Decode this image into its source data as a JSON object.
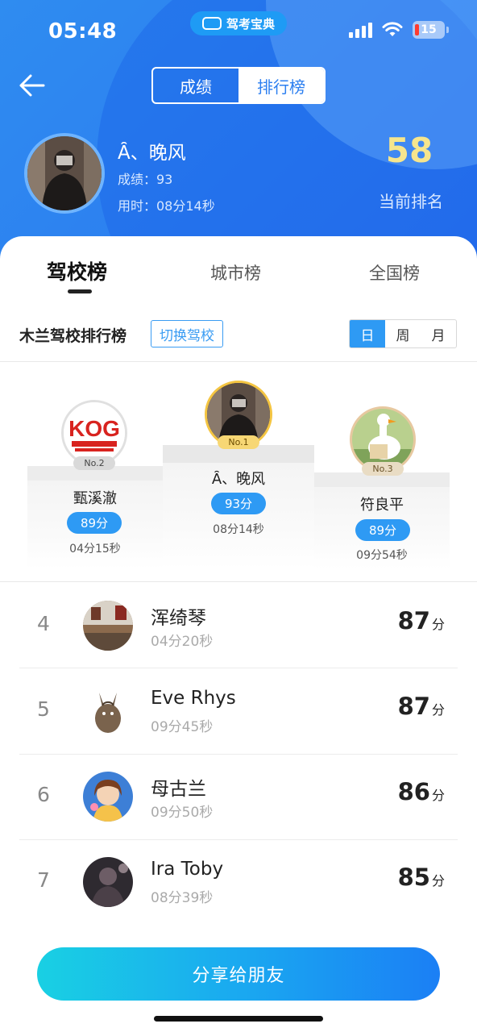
{
  "status_bar": {
    "time": "05:48",
    "app_badge": "驾考宝典",
    "battery": "15"
  },
  "nav": {
    "back_icon": "back-arrow-icon",
    "segments": [
      {
        "label": "成绩",
        "active": false
      },
      {
        "label": "排行榜",
        "active": true
      }
    ]
  },
  "me": {
    "name": "Ȃ、晚风",
    "score_text": "成绩：93",
    "time_text": "用时：08分14秒",
    "rank": "58",
    "rank_label": "当前排名"
  },
  "tabs": [
    {
      "label": "驾校榜",
      "active": true
    },
    {
      "label": "城市榜",
      "active": false
    },
    {
      "label": "全国榜",
      "active": false
    }
  ],
  "school_bar": {
    "title": "木兰驾校排行榜",
    "switch_label": "切换驾校",
    "periods": [
      {
        "label": "日",
        "active": true
      },
      {
        "label": "周",
        "active": false
      },
      {
        "label": "月",
        "active": false
      }
    ]
  },
  "podium": {
    "first": {
      "tag": "No.1",
      "name": "Ȃ、晚风",
      "score": "93分",
      "time": "08分14秒"
    },
    "second": {
      "tag": "No.2",
      "name": "甄溪澈",
      "score": "89分",
      "time": "04分15秒",
      "avatar_text": "KOG"
    },
    "third": {
      "tag": "No.3",
      "name": "符良平",
      "score": "89分",
      "time": "09分54秒"
    }
  },
  "list": [
    {
      "rank": "4",
      "name": "浑绮琴",
      "time": "04分20秒",
      "score": "87",
      "unit": "分"
    },
    {
      "rank": "5",
      "name": "Eve Rhys",
      "time": "09分45秒",
      "score": "87",
      "unit": "分"
    },
    {
      "rank": "6",
      "name": "母古兰",
      "time": "09分50秒",
      "score": "86",
      "unit": "分"
    },
    {
      "rank": "7",
      "name": "Ira Toby",
      "time": "08分39秒",
      "score": "85",
      "unit": "分"
    }
  ],
  "share_button": "分享给朋友",
  "colors": {
    "primary": "#2c7ff0",
    "accent_blue": "#2e9af4",
    "rank_gold": "#f6e58d"
  }
}
